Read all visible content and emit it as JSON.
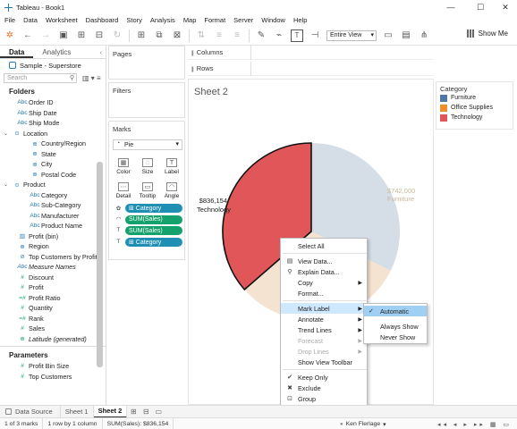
{
  "window": {
    "title": "Tableau - Book1",
    "minimize": "—",
    "maximize": "☐",
    "close": "✕"
  },
  "menu": [
    "File",
    "Data",
    "Worksheet",
    "Dashboard",
    "Story",
    "Analysis",
    "Map",
    "Format",
    "Server",
    "Window",
    "Help"
  ],
  "toolbar": {
    "view_mode": "Entire View",
    "show_me": "Show Me"
  },
  "data_pane": {
    "tabs": [
      "Data",
      "Analytics"
    ],
    "datasource": "Sample - Superstore",
    "search_placeholder": "Search",
    "folders_header": "Folders",
    "parameters_header": "Parameters",
    "fields": [
      {
        "icon": "Abc",
        "name": "Order ID",
        "level": 1,
        "kind": "dim"
      },
      {
        "icon": "Abc",
        "name": "Ship Date",
        "level": 1,
        "kind": "dim"
      },
      {
        "icon": "Abc",
        "name": "Ship Mode",
        "level": 1,
        "kind": "dim"
      },
      {
        "icon": "⊙",
        "name": "Location",
        "level": 0,
        "kind": "dim",
        "folder": true
      },
      {
        "icon": "⊕",
        "name": "Country/Region",
        "level": 2,
        "kind": "dim"
      },
      {
        "icon": "⊕",
        "name": "State",
        "level": 2,
        "kind": "dim"
      },
      {
        "icon": "⊕",
        "name": "City",
        "level": 2,
        "kind": "dim"
      },
      {
        "icon": "⊕",
        "name": "Postal Code",
        "level": 2,
        "kind": "dim"
      },
      {
        "icon": "⊙",
        "name": "Product",
        "level": 0,
        "kind": "dim",
        "folder": true
      },
      {
        "icon": "Abc",
        "name": "Category",
        "level": 2,
        "kind": "dim"
      },
      {
        "icon": "Abc",
        "name": "Sub-Category",
        "level": 2,
        "kind": "dim"
      },
      {
        "icon": "Abc",
        "name": "Manufacturer",
        "level": 2,
        "kind": "dim"
      },
      {
        "icon": "Abc",
        "name": "Product Name",
        "level": 2,
        "kind": "dim"
      },
      {
        "icon": "▥",
        "name": "Profit (bin)",
        "level": 1,
        "kind": "dim"
      },
      {
        "icon": "⊕",
        "name": "Region",
        "level": 1,
        "kind": "dim"
      },
      {
        "icon": "⊘",
        "name": "Top Customers by Profit",
        "level": 1,
        "kind": "dim"
      },
      {
        "icon": "Abc",
        "name": "Measure Names",
        "level": 1,
        "kind": "dim",
        "italic": true
      },
      {
        "icon": "#",
        "name": "Discount",
        "level": 1,
        "kind": "meas"
      },
      {
        "icon": "#",
        "name": "Profit",
        "level": 1,
        "kind": "meas"
      },
      {
        "icon": "=#",
        "name": "Profit Ratio",
        "level": 1,
        "kind": "meas"
      },
      {
        "icon": "#",
        "name": "Quantity",
        "level": 1,
        "kind": "meas"
      },
      {
        "icon": "=#",
        "name": "Rank",
        "level": 1,
        "kind": "meas"
      },
      {
        "icon": "#",
        "name": "Sales",
        "level": 1,
        "kind": "meas"
      },
      {
        "icon": "⊕",
        "name": "Latitude (generated)",
        "level": 1,
        "kind": "meas",
        "italic": true
      }
    ],
    "parameters": [
      {
        "icon": "#",
        "name": "Profit Bin Size"
      },
      {
        "icon": "#",
        "name": "Top Customers"
      }
    ]
  },
  "shelves": {
    "pages": "Pages",
    "filters": "Filters",
    "columns": "Columns",
    "rows": "Rows"
  },
  "marks": {
    "title": "Marks",
    "type": "Pie",
    "buttons": [
      {
        "label": "Color",
        "glyph": "▦"
      },
      {
        "label": "Size",
        "glyph": "◌"
      },
      {
        "label": "Label",
        "glyph": "T"
      },
      {
        "label": "Detail",
        "glyph": "⋯"
      },
      {
        "label": "Tooltip",
        "glyph": "▭"
      },
      {
        "label": "Angle",
        "glyph": "◠"
      }
    ],
    "pills": [
      {
        "icon": "✿",
        "text": "⊞ Category",
        "kind": "dim"
      },
      {
        "icon": "◠",
        "text": "SUM(Sales)",
        "kind": "meas"
      },
      {
        "icon": "T",
        "text": "SUM(Sales)",
        "kind": "meas"
      },
      {
        "icon": "T",
        "text": "⊞ Category",
        "kind": "dim"
      }
    ]
  },
  "sheet": {
    "title": "Sheet 2",
    "labels": {
      "technology_value": "$836,154",
      "technology_name": "Technology",
      "furniture_value": "$742,000",
      "furniture_name": "Furniture"
    }
  },
  "chart_data": {
    "type": "pie",
    "categories": [
      "Technology",
      "Furniture",
      "Office Supplies"
    ],
    "values": [
      836154,
      742000,
      719047
    ],
    "colors": {
      "Technology": "#e15759",
      "Furniture": "#d5dde6",
      "Office Supplies": "#f4e3d0"
    },
    "highlighted": "Technology"
  },
  "legend": {
    "title": "Category",
    "items": [
      {
        "label": "Furniture",
        "color": "#4e79a7"
      },
      {
        "label": "Office Supplies",
        "color": "#f28e2b"
      },
      {
        "label": "Technology",
        "color": "#e15759"
      }
    ]
  },
  "context_menu": {
    "items": [
      {
        "label": "Select All",
        "icon": "",
        "arrow": false,
        "disabled": false,
        "sep_after": true
      },
      {
        "label": "View Data...",
        "icon": "▤",
        "arrow": false,
        "disabled": false
      },
      {
        "label": "Explain Data...",
        "icon": "⚲",
        "arrow": false,
        "disabled": false
      },
      {
        "label": "Copy",
        "icon": "",
        "arrow": true,
        "disabled": false
      },
      {
        "label": "Format...",
        "icon": "",
        "arrow": false,
        "disabled": false,
        "sep_after": true
      },
      {
        "label": "Mark Label",
        "icon": "",
        "arrow": true,
        "disabled": false,
        "highlight": true
      },
      {
        "label": "Annotate",
        "icon": "",
        "arrow": true,
        "disabled": false
      },
      {
        "label": "Trend Lines",
        "icon": "",
        "arrow": true,
        "disabled": false
      },
      {
        "label": "Forecast",
        "icon": "",
        "arrow": true,
        "disabled": true
      },
      {
        "label": "Drop Lines",
        "icon": "",
        "arrow": true,
        "disabled": true
      },
      {
        "label": "Show View Toolbar",
        "icon": "",
        "arrow": false,
        "disabled": false,
        "sep_after": true
      },
      {
        "label": "Keep Only",
        "icon": "✔",
        "arrow": false,
        "disabled": false
      },
      {
        "label": "Exclude",
        "icon": "✖",
        "arrow": false,
        "disabled": false
      },
      {
        "label": "Group",
        "icon": "⊡",
        "arrow": false,
        "disabled": false
      },
      {
        "label": "Create Set...",
        "icon": "⊚",
        "arrow": false,
        "disabled": false
      }
    ]
  },
  "submenu": {
    "items": [
      {
        "label": "Automatic",
        "checked": true,
        "highlight": true
      },
      {
        "label": "Always Show",
        "checked": false,
        "highlight": false
      },
      {
        "label": "Never Show",
        "checked": false,
        "highlight": false
      }
    ]
  },
  "tabs": {
    "datasource": "Data Source",
    "sheets": [
      "Sheet 1",
      "Sheet 2"
    ],
    "active": "Sheet 2"
  },
  "status": {
    "marks": "1 of 3 marks",
    "rows": "1 row by 1 column",
    "sum": "SUM(Sales): $836,154",
    "user": "Ken Flerlage",
    "nav": "◂◂ ◂ ▸ ▸▸ ▦ ▭"
  }
}
